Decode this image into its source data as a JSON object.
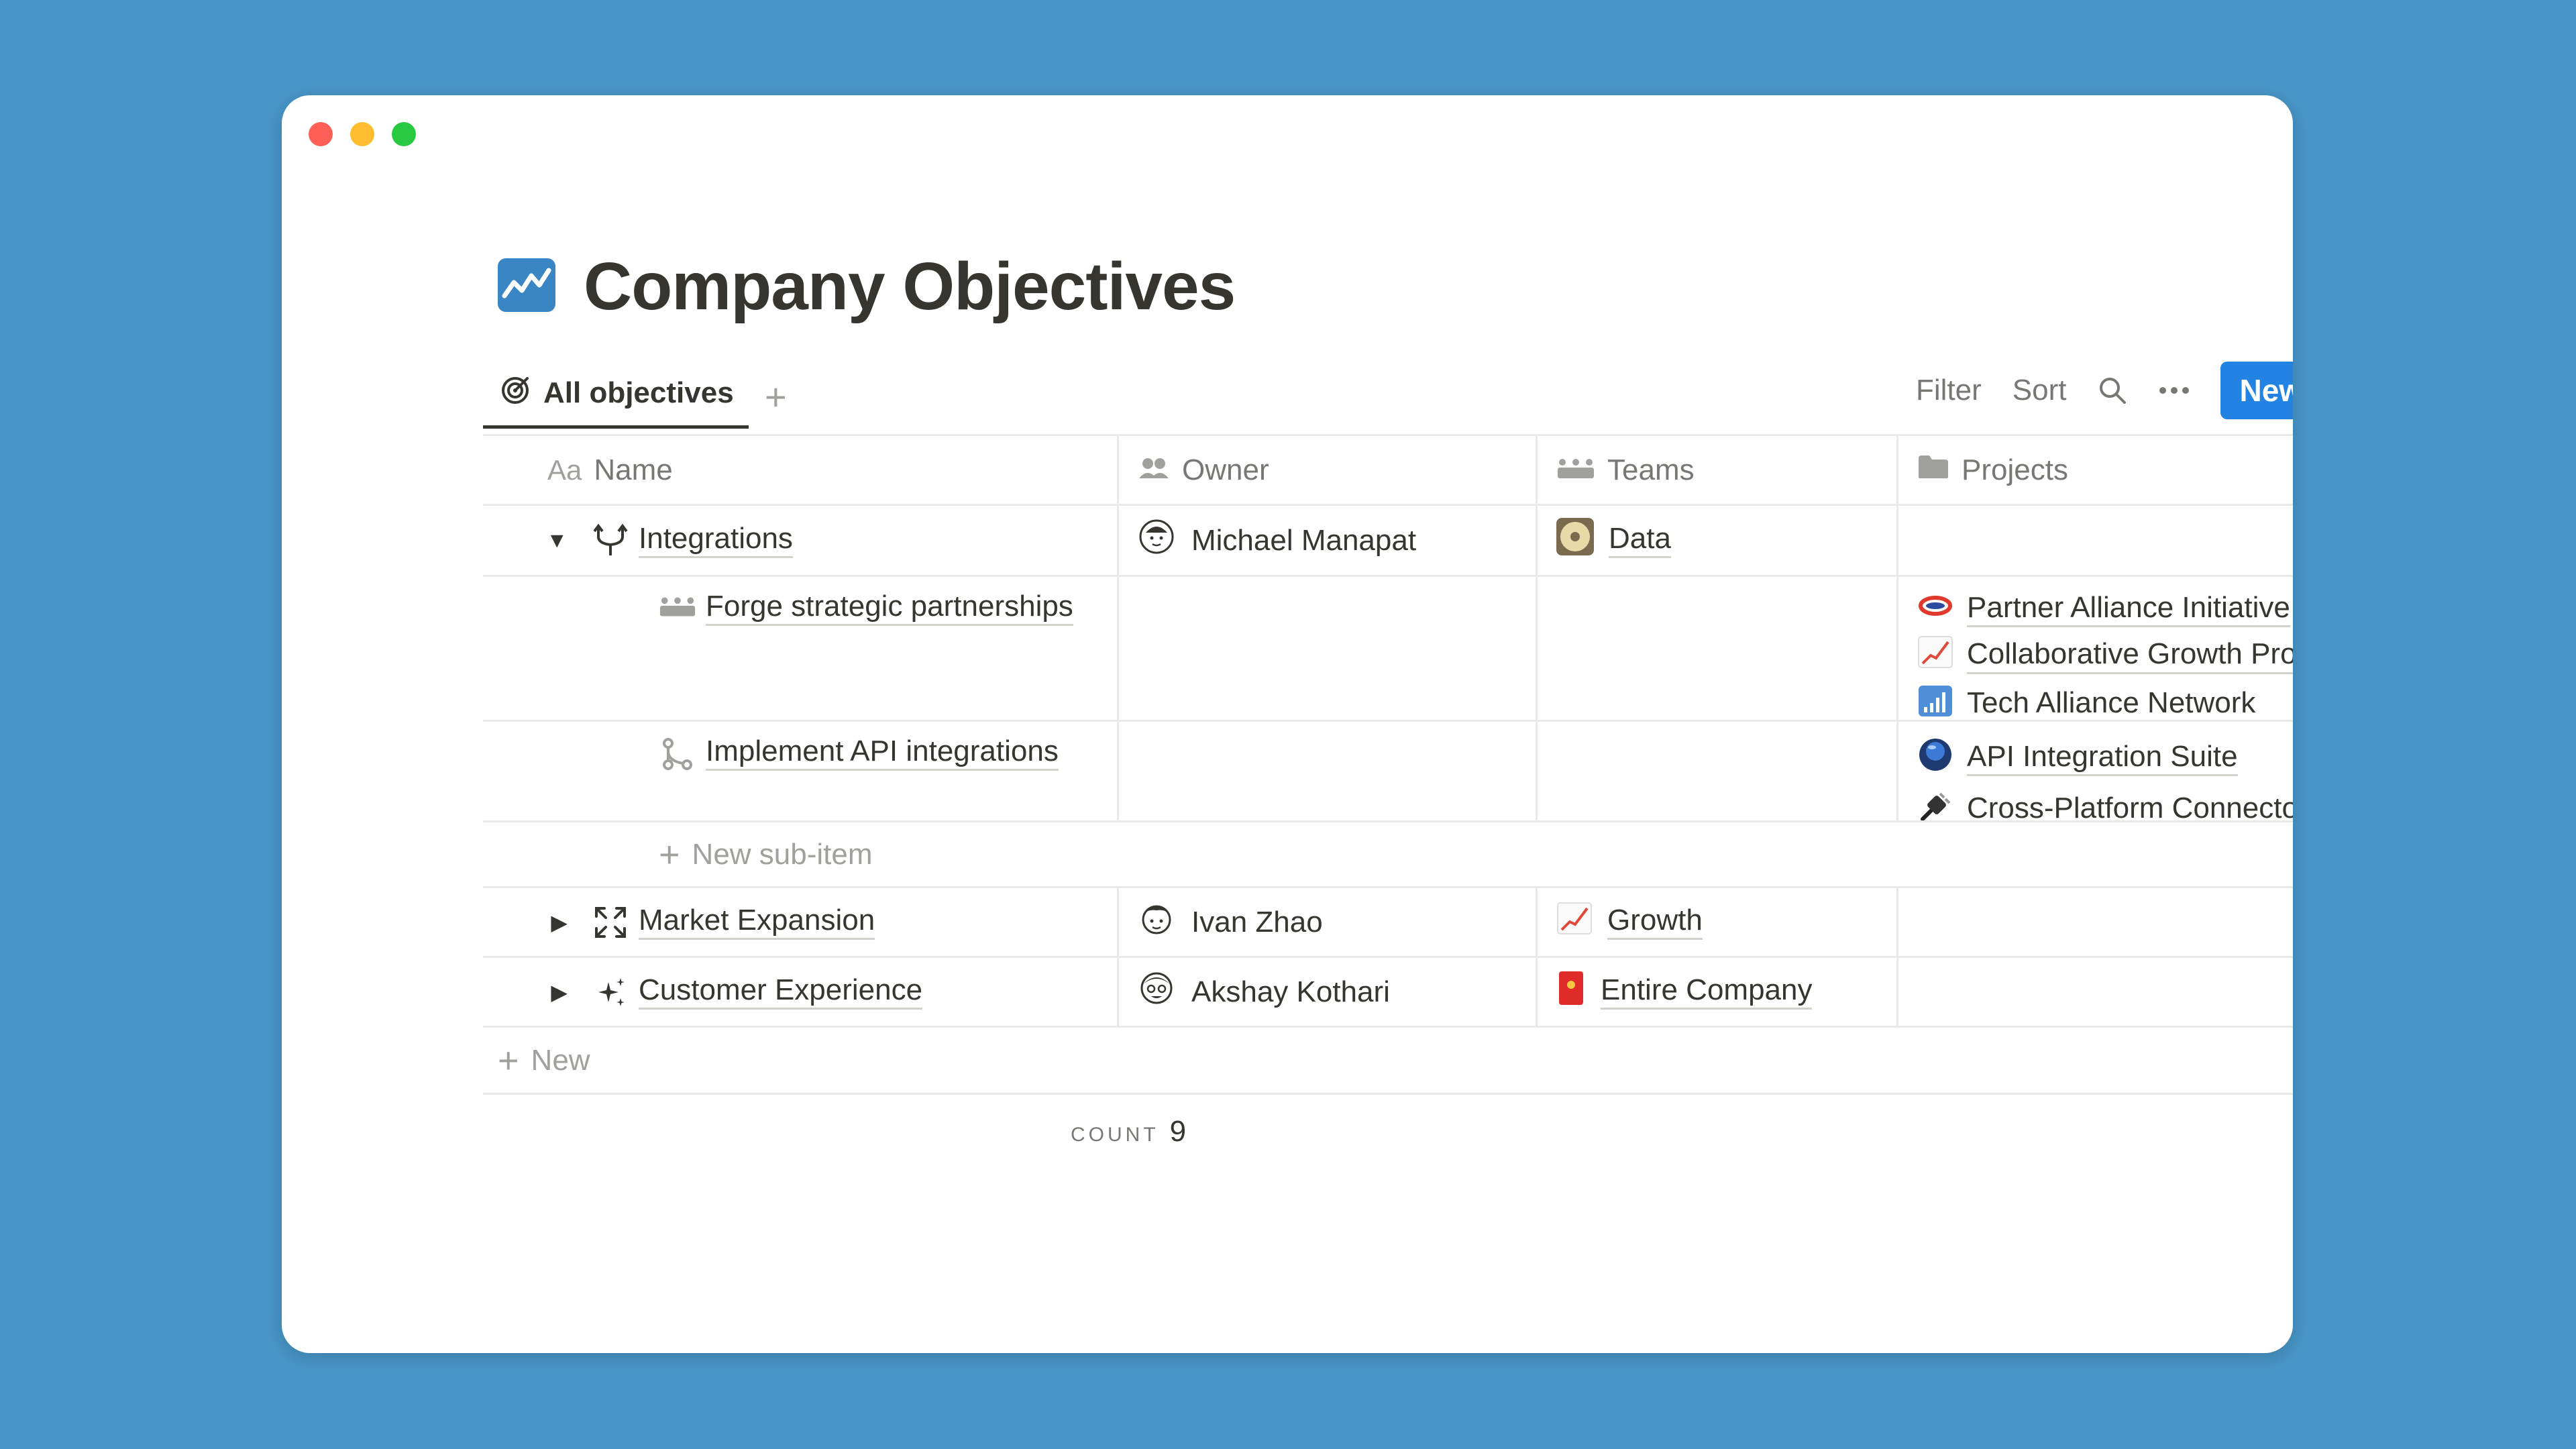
{
  "page": {
    "title": "Company Objectives"
  },
  "view": {
    "active_tab": "All objectives",
    "add_tab": "+"
  },
  "toolbar": {
    "filter": "Filter",
    "sort": "Sort",
    "new_label": "New"
  },
  "columns": {
    "name": "Name",
    "name_prefix": "Aa",
    "owner": "Owner",
    "teams": "Teams",
    "projects": "Projects"
  },
  "rows": [
    {
      "name": "Integrations",
      "owner": "Michael Manapat",
      "team": "Data",
      "expanded": true
    },
    {
      "name": "Market Expansion",
      "owner": "Ivan Zhao",
      "team": "Growth",
      "expanded": false
    },
    {
      "name": "Customer Experience",
      "owner": "Akshay Kothari",
      "team": "Entire Company",
      "expanded": false
    }
  ],
  "subitems": [
    {
      "name": "Forge strategic partnerships",
      "projects": [
        "Partner Alliance Initiative",
        "Collaborative Growth Program",
        "Tech Alliance Network"
      ]
    },
    {
      "name": "Implement API integrations",
      "projects": [
        "API Integration Suite",
        "Cross-Platform Connector"
      ]
    }
  ],
  "new_subitem": "New sub-item",
  "new_row": "New",
  "footer": {
    "count_label": "COUNT",
    "count_value": "9"
  },
  "colors": {
    "accent": "#2383e2",
    "background": "#4896c8"
  }
}
